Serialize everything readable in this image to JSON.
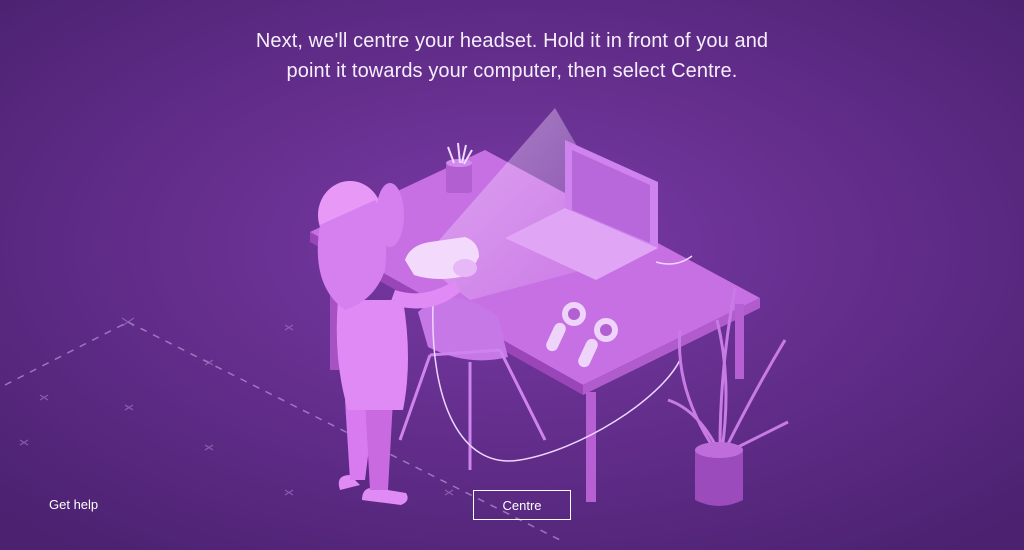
{
  "instruction": {
    "line1": "Next, we'll centre your headset. Hold it in front of you and",
    "line2": "point it towards your computer, then select Centre."
  },
  "footer": {
    "get_help_label": "Get help",
    "centre_label": "Centre"
  },
  "colors": {
    "background": "#5a2a82",
    "illustration_pink": "#d98cf0",
    "floor_marks": "#a77bc4"
  }
}
